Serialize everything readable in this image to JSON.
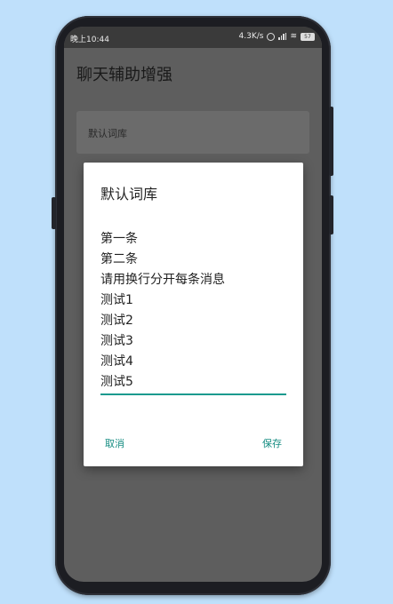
{
  "status": {
    "time": "晚上10:44",
    "speed": "4.3K/s",
    "battery": "57"
  },
  "app": {
    "title": "聊天辅助增强"
  },
  "list": {
    "item_label": "默认词库"
  },
  "dialog": {
    "title": "默认词库",
    "lines": [
      "第一条",
      "第二条",
      "请用换行分开每条消息",
      "测试1",
      "测试2",
      "测试3",
      "测试4",
      "测试5"
    ],
    "cancel_label": "取消",
    "save_label": "保存"
  },
  "colors": {
    "accent": "#168d82",
    "background": "#bfe0fb",
    "screen_dim": "#5e5e5e"
  }
}
